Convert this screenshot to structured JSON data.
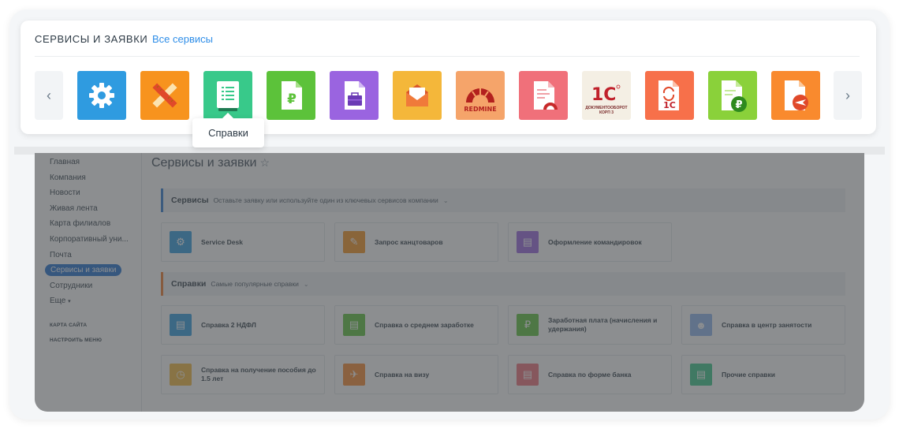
{
  "card": {
    "title": "СЕРВИСЫ И ЗАЯВКИ",
    "all_services_link": "Все сервисы",
    "tooltip": "Справки",
    "prev_icon": "chevron-left-icon",
    "next_icon": "chevron-right-icon",
    "services": [
      {
        "icon": "gear-icon",
        "color": "#2f9be0"
      },
      {
        "icon": "pencil-ruler-icon",
        "color": "#f7931e"
      },
      {
        "icon": "document-list-icon",
        "color": "#38c98a"
      },
      {
        "icon": "ruble-document-icon",
        "color": "#5cc23a"
      },
      {
        "icon": "briefcase-document-icon",
        "color": "#9a64e0"
      },
      {
        "icon": "envelope-icon",
        "color": "#f4b73a"
      },
      {
        "icon": "redmine-logo-icon",
        "color": "#f5a46a",
        "label": "REDMINE"
      },
      {
        "icon": "document-redmine-icon",
        "color": "#f0707a"
      },
      {
        "icon": "1c-logo-icon",
        "color": "#f4efe4",
        "label": "1С",
        "sublabel": "ДОКУМЕНТООБОРОТ КОРП 3"
      },
      {
        "icon": "1c-sync-document-icon",
        "color": "#f7704a"
      },
      {
        "icon": "ruble-document-icon",
        "color": "#8ad13a"
      },
      {
        "icon": "plane-document-icon",
        "color": "#f98a2e"
      }
    ]
  },
  "portal": {
    "title": "Сервисы и заявки",
    "sidebar": {
      "items": [
        "Главная",
        "Компания",
        "Новости",
        "Живая лента",
        "Карта филиалов",
        "Корпоративный уни...",
        "Почта",
        "Сервисы и заявки",
        "Сотрудники",
        "Еще"
      ],
      "small": [
        "КАРТА САЙТА",
        "НАСТРОИТЬ МЕНЮ"
      ]
    },
    "sections": [
      {
        "title": "Сервисы",
        "desc": "Оставьте заявку или используйте один из ключевых сервисов компании",
        "tiles": [
          {
            "label": "Service Desk",
            "color": "#2f9be0"
          },
          {
            "label": "Запрос канцтоваров",
            "color": "#f7931e"
          },
          {
            "label": "Оформление командировок",
            "color": "#9a64e0"
          }
        ]
      },
      {
        "title": "Справки",
        "desc": "Самые популярные справки",
        "tiles": [
          {
            "label": "Справка 2 НДФЛ",
            "color": "#2f9be0"
          },
          {
            "label": "Справка о среднем заработке",
            "color": "#5cc23a"
          },
          {
            "label": "Заработная плата (начисления и удержания)",
            "color": "#5cc23a"
          },
          {
            "label": "Справка в центр занятости",
            "color": "#8fb5f0"
          },
          {
            "label": "Справка на получение пособия до 1.5 лет",
            "color": "#f4b73a"
          },
          {
            "label": "Справка на визу",
            "color": "#f98a2e"
          },
          {
            "label": "Справка по форме банка",
            "color": "#f0707a"
          },
          {
            "label": "Прочие справки",
            "color": "#38c98a"
          }
        ]
      }
    ]
  }
}
